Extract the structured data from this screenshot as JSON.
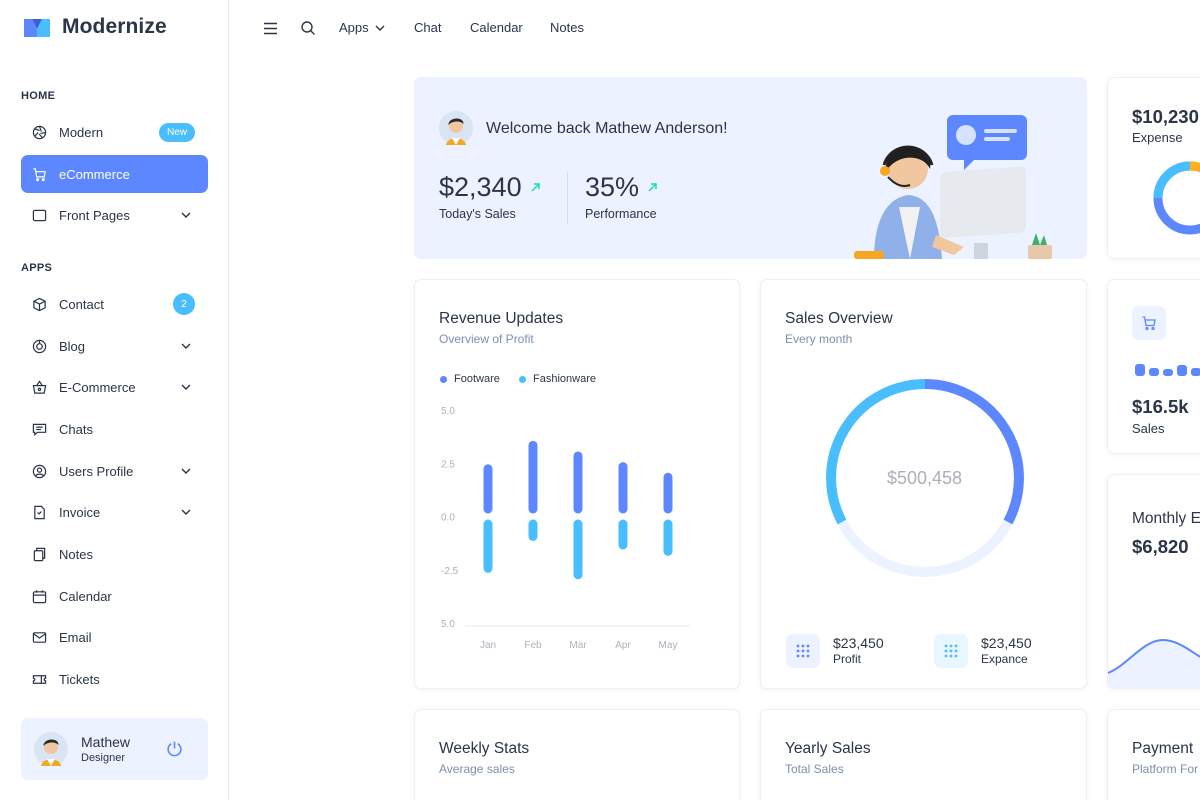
{
  "brand": {
    "name": "Modernize"
  },
  "sidebar": {
    "caption_home": "HOME",
    "caption_apps": "APPS",
    "items": [
      {
        "label": "Modern",
        "icon": "aperture-icon",
        "badge": "New"
      },
      {
        "label": "eCommerce",
        "icon": "shopping-cart-icon",
        "active": true
      },
      {
        "label": "Front Pages",
        "icon": "layout-icon",
        "expandable": true
      },
      {
        "label": "Contact",
        "icon": "package-icon",
        "badge": "2"
      },
      {
        "label": "Blog",
        "icon": "chart-donut-icon",
        "expandable": true
      },
      {
        "label": "E-Commerce",
        "icon": "basket-icon",
        "expandable": true
      },
      {
        "label": "Chats",
        "icon": "message-icon"
      },
      {
        "label": "Users Profile",
        "icon": "user-circle-icon",
        "expandable": true
      },
      {
        "label": "Invoice",
        "icon": "file-text-icon",
        "expandable": true
      },
      {
        "label": "Notes",
        "icon": "notes-icon"
      },
      {
        "label": "Calendar",
        "icon": "calendar-icon"
      },
      {
        "label": "Email",
        "icon": "mail-icon"
      },
      {
        "label": "Tickets",
        "icon": "ticket-icon"
      }
    ],
    "profile": {
      "name": "Mathew",
      "role": "Designer"
    }
  },
  "header": {
    "links": {
      "apps": "Apps",
      "chat": "Chat",
      "calendar": "Calendar",
      "notes": "Notes"
    }
  },
  "welcome": {
    "title": "Welcome back Mathew Anderson!",
    "sales_value": "$2,340",
    "sales_label": "Today's Sales",
    "performance_value": "35%",
    "performance_label": "Performance"
  },
  "expense_card": {
    "value": "$10,230",
    "label": "Expense"
  },
  "revenue": {
    "title": "Revenue Updates",
    "subtitle": "Overview of Profit",
    "legend": [
      "Footware",
      "Fashionware"
    ],
    "colors": [
      "#5d87ff",
      "#49beff"
    ]
  },
  "sales_overview": {
    "title": "Sales Overview",
    "subtitle": "Every month",
    "center_value": "$500,458",
    "profit_value": "$23,450",
    "profit_label": "Profit",
    "expance_value": "$23,450",
    "expance_label": "Expance"
  },
  "sales_card": {
    "value": "$16.5k",
    "label": "Sales"
  },
  "monthly_card": {
    "title": "Monthly E",
    "value": "$6,820"
  },
  "weekly": {
    "title": "Weekly Stats",
    "subtitle": "Average sales"
  },
  "yearly": {
    "title": "Yearly Sales",
    "subtitle": "Total Sales"
  },
  "payment": {
    "title": "Payment",
    "subtitle": "Platform For"
  },
  "chart_data": {
    "type": "bar",
    "title": "Revenue Updates",
    "categories": [
      "Jan",
      "Feb",
      "Mar",
      "Apr",
      "May"
    ],
    "y_ticks": [
      "5.0",
      "2.5",
      "0.0",
      "-2.5",
      "5.0"
    ],
    "ylim": [
      -5,
      5
    ],
    "series": [
      {
        "name": "Footware",
        "values": [
          2.5,
          3.6,
          3.1,
          2.6,
          2.1
        ]
      },
      {
        "name": "Fashionware",
        "values": [
          -2.6,
          -1.1,
          -2.9,
          -1.5,
          -1.8
        ]
      }
    ]
  }
}
